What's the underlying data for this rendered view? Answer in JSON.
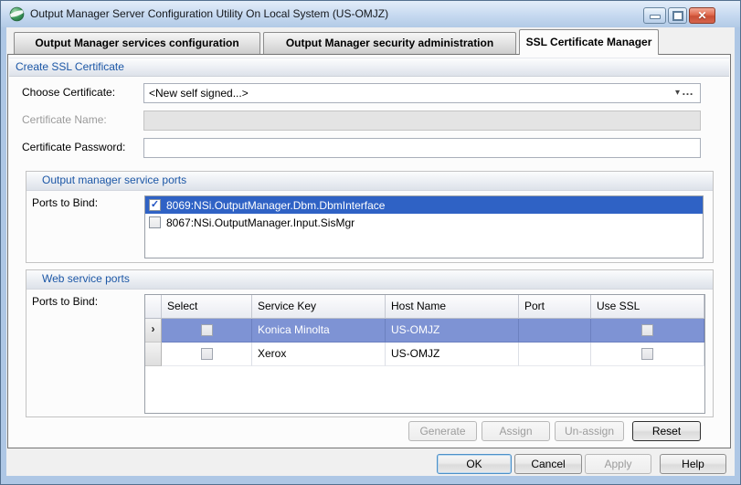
{
  "window": {
    "title": "Output Manager Server Configuration Utility On Local System (US-OMJZ)"
  },
  "icons": {
    "close": "✕",
    "dropdown_arrow": "▾",
    "ellipsis": "…",
    "check": "✓",
    "row_indicator": "›"
  },
  "tabs": [
    {
      "label": "Output Manager services configuration",
      "active": false
    },
    {
      "label": "Output Manager security administration",
      "active": false
    },
    {
      "label": "SSL Certificate Manager",
      "active": true
    }
  ],
  "create_ssl": {
    "section_title": "Create SSL Certificate",
    "choose_certificate": {
      "label": "Choose Certificate:",
      "value": "<New self signed...>"
    },
    "certificate_name": {
      "label": "Certificate Name:",
      "value": "",
      "disabled": true
    },
    "certificate_password": {
      "label": "Certificate Password:",
      "value": ""
    }
  },
  "service_ports": {
    "section_title": "Output manager service ports",
    "ports_label": "Ports to Bind:",
    "items": [
      {
        "text": "8069:NSi.OutputManager.Dbm.DbmInterface",
        "checked": true,
        "selected": true
      },
      {
        "text": "8067:NSi.OutputManager.Input.SisMgr",
        "checked": false,
        "selected": false
      }
    ]
  },
  "web_service_ports": {
    "section_title": "Web service ports",
    "ports_label": "Ports to Bind:",
    "grid": {
      "columns": [
        "Select",
        "Service Key",
        "Host Name",
        "Port",
        "Use SSL"
      ],
      "rows": [
        {
          "select_checked": false,
          "service_key": "Konica Minolta",
          "host_name": "US-OMJZ",
          "port": "",
          "use_ssl_checked": false,
          "selected": true
        },
        {
          "select_checked": false,
          "service_key": "Xerox",
          "host_name": "US-OMJZ",
          "port": "",
          "use_ssl_checked": false,
          "selected": false
        }
      ]
    }
  },
  "action_buttons": [
    {
      "label": "Generate",
      "enabled": false
    },
    {
      "label": "Assign",
      "enabled": false
    },
    {
      "label": "Un-assign",
      "enabled": false
    },
    {
      "label": "Reset",
      "enabled": true
    }
  ],
  "dialog_buttons": [
    {
      "label": "OK",
      "enabled": true,
      "focused": true
    },
    {
      "label": "Cancel",
      "enabled": true
    },
    {
      "label": "Apply",
      "enabled": false
    },
    {
      "label": "Help",
      "enabled": true
    }
  ],
  "colors": {
    "frame_blue": "#aec7e5",
    "selection_blue": "#2f62c5",
    "grid_selection_blue": "#7e93d4",
    "section_text_blue": "#1c57a6",
    "close_button_red": "#d6654e"
  }
}
